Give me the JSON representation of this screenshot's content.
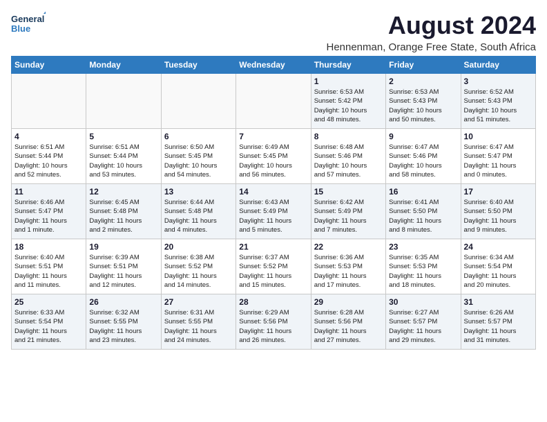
{
  "logo": {
    "line1": "General",
    "line2": "Blue"
  },
  "title": "August 2024",
  "location": "Hennenman, Orange Free State, South Africa",
  "weekdays": [
    "Sunday",
    "Monday",
    "Tuesday",
    "Wednesday",
    "Thursday",
    "Friday",
    "Saturday"
  ],
  "weeks": [
    [
      {
        "day": "",
        "info": ""
      },
      {
        "day": "",
        "info": ""
      },
      {
        "day": "",
        "info": ""
      },
      {
        "day": "",
        "info": ""
      },
      {
        "day": "1",
        "info": "Sunrise: 6:53 AM\nSunset: 5:42 PM\nDaylight: 10 hours\nand 48 minutes."
      },
      {
        "day": "2",
        "info": "Sunrise: 6:53 AM\nSunset: 5:43 PM\nDaylight: 10 hours\nand 50 minutes."
      },
      {
        "day": "3",
        "info": "Sunrise: 6:52 AM\nSunset: 5:43 PM\nDaylight: 10 hours\nand 51 minutes."
      }
    ],
    [
      {
        "day": "4",
        "info": "Sunrise: 6:51 AM\nSunset: 5:44 PM\nDaylight: 10 hours\nand 52 minutes."
      },
      {
        "day": "5",
        "info": "Sunrise: 6:51 AM\nSunset: 5:44 PM\nDaylight: 10 hours\nand 53 minutes."
      },
      {
        "day": "6",
        "info": "Sunrise: 6:50 AM\nSunset: 5:45 PM\nDaylight: 10 hours\nand 54 minutes."
      },
      {
        "day": "7",
        "info": "Sunrise: 6:49 AM\nSunset: 5:45 PM\nDaylight: 10 hours\nand 56 minutes."
      },
      {
        "day": "8",
        "info": "Sunrise: 6:48 AM\nSunset: 5:46 PM\nDaylight: 10 hours\nand 57 minutes."
      },
      {
        "day": "9",
        "info": "Sunrise: 6:47 AM\nSunset: 5:46 PM\nDaylight: 10 hours\nand 58 minutes."
      },
      {
        "day": "10",
        "info": "Sunrise: 6:47 AM\nSunset: 5:47 PM\nDaylight: 11 hours\nand 0 minutes."
      }
    ],
    [
      {
        "day": "11",
        "info": "Sunrise: 6:46 AM\nSunset: 5:47 PM\nDaylight: 11 hours\nand 1 minute."
      },
      {
        "day": "12",
        "info": "Sunrise: 6:45 AM\nSunset: 5:48 PM\nDaylight: 11 hours\nand 2 minutes."
      },
      {
        "day": "13",
        "info": "Sunrise: 6:44 AM\nSunset: 5:48 PM\nDaylight: 11 hours\nand 4 minutes."
      },
      {
        "day": "14",
        "info": "Sunrise: 6:43 AM\nSunset: 5:49 PM\nDaylight: 11 hours\nand 5 minutes."
      },
      {
        "day": "15",
        "info": "Sunrise: 6:42 AM\nSunset: 5:49 PM\nDaylight: 11 hours\nand 7 minutes."
      },
      {
        "day": "16",
        "info": "Sunrise: 6:41 AM\nSunset: 5:50 PM\nDaylight: 11 hours\nand 8 minutes."
      },
      {
        "day": "17",
        "info": "Sunrise: 6:40 AM\nSunset: 5:50 PM\nDaylight: 11 hours\nand 9 minutes."
      }
    ],
    [
      {
        "day": "18",
        "info": "Sunrise: 6:40 AM\nSunset: 5:51 PM\nDaylight: 11 hours\nand 11 minutes."
      },
      {
        "day": "19",
        "info": "Sunrise: 6:39 AM\nSunset: 5:51 PM\nDaylight: 11 hours\nand 12 minutes."
      },
      {
        "day": "20",
        "info": "Sunrise: 6:38 AM\nSunset: 5:52 PM\nDaylight: 11 hours\nand 14 minutes."
      },
      {
        "day": "21",
        "info": "Sunrise: 6:37 AM\nSunset: 5:52 PM\nDaylight: 11 hours\nand 15 minutes."
      },
      {
        "day": "22",
        "info": "Sunrise: 6:36 AM\nSunset: 5:53 PM\nDaylight: 11 hours\nand 17 minutes."
      },
      {
        "day": "23",
        "info": "Sunrise: 6:35 AM\nSunset: 5:53 PM\nDaylight: 11 hours\nand 18 minutes."
      },
      {
        "day": "24",
        "info": "Sunrise: 6:34 AM\nSunset: 5:54 PM\nDaylight: 11 hours\nand 20 minutes."
      }
    ],
    [
      {
        "day": "25",
        "info": "Sunrise: 6:33 AM\nSunset: 5:54 PM\nDaylight: 11 hours\nand 21 minutes."
      },
      {
        "day": "26",
        "info": "Sunrise: 6:32 AM\nSunset: 5:55 PM\nDaylight: 11 hours\nand 23 minutes."
      },
      {
        "day": "27",
        "info": "Sunrise: 6:31 AM\nSunset: 5:55 PM\nDaylight: 11 hours\nand 24 minutes."
      },
      {
        "day": "28",
        "info": "Sunrise: 6:29 AM\nSunset: 5:56 PM\nDaylight: 11 hours\nand 26 minutes."
      },
      {
        "day": "29",
        "info": "Sunrise: 6:28 AM\nSunset: 5:56 PM\nDaylight: 11 hours\nand 27 minutes."
      },
      {
        "day": "30",
        "info": "Sunrise: 6:27 AM\nSunset: 5:57 PM\nDaylight: 11 hours\nand 29 minutes."
      },
      {
        "day": "31",
        "info": "Sunrise: 6:26 AM\nSunset: 5:57 PM\nDaylight: 11 hours\nand 31 minutes."
      }
    ]
  ]
}
